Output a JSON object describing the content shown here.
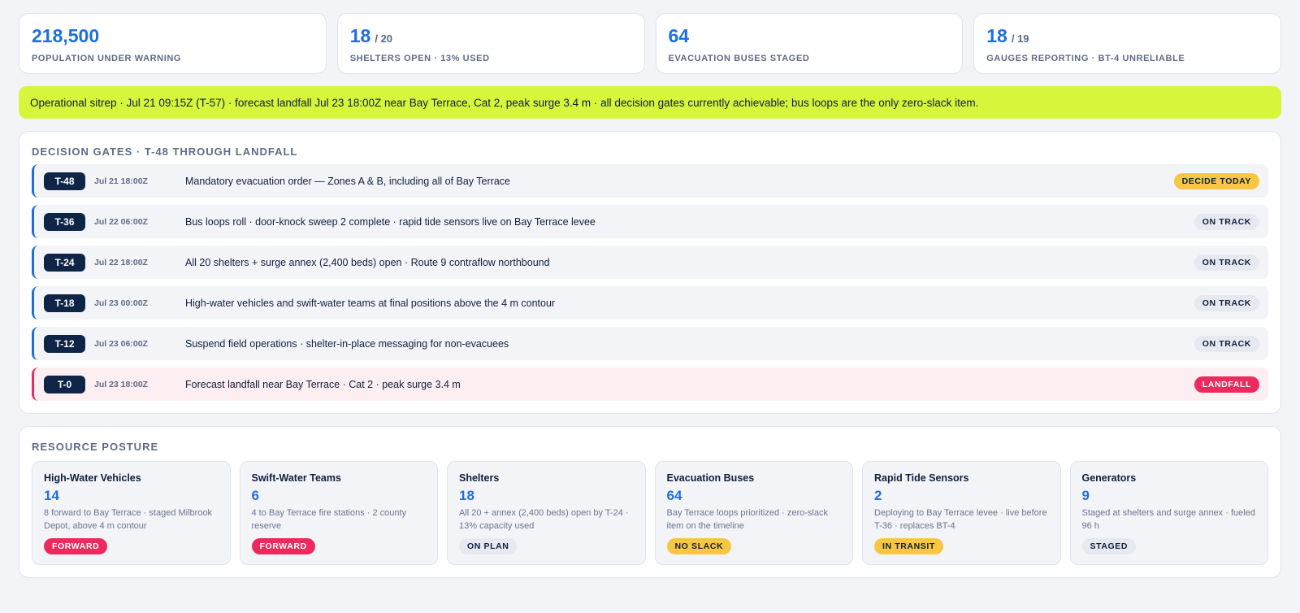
{
  "kpis": [
    {
      "value": "218,500",
      "denominator": "",
      "label": "POPULATION UNDER WARNING"
    },
    {
      "value": "18",
      "denominator": "/ 20",
      "label": "SHELTERS OPEN · 13% USED"
    },
    {
      "value": "64",
      "denominator": "",
      "label": "EVACUATION BUSES STAGED"
    },
    {
      "value": "18",
      "denominator": "/ 19",
      "label": "GAUGES REPORTING · BT-4 UNRELIABLE"
    }
  ],
  "banner": "Operational sitrep · Jul 21 09:15Z (T-57) · forecast landfall Jul 23 18:00Z near Bay Terrace, Cat 2, peak surge 3.4 m · all decision gates currently achievable; bus loops are the only zero-slack item.",
  "gates_section": {
    "title": "DECISION GATES · T-48 THROUGH LANDFALL",
    "gates": [
      {
        "tag": "T-48",
        "time": "Jul 21 18:00Z",
        "desc": "Mandatory evacuation order — Zones A & B, including all of Bay Terrace",
        "status": "DECIDE TODAY",
        "tone": "yellow"
      },
      {
        "tag": "T-36",
        "time": "Jul 22 06:00Z",
        "desc": "Bus loops roll · door-knock sweep 2 complete · rapid tide sensors live on Bay Terrace levee",
        "status": "ON TRACK",
        "tone": "grey"
      },
      {
        "tag": "T-24",
        "time": "Jul 22 18:00Z",
        "desc": "All 20 shelters + surge annex (2,400 beds) open · Route 9 contraflow northbound",
        "status": "ON TRACK",
        "tone": "grey"
      },
      {
        "tag": "T-18",
        "time": "Jul 23 00:00Z",
        "desc": "High-water vehicles and swift-water teams at final positions above the 4 m contour",
        "status": "ON TRACK",
        "tone": "grey"
      },
      {
        "tag": "T-12",
        "time": "Jul 23 06:00Z",
        "desc": "Suspend field operations · shelter-in-place messaging for non-evacuees",
        "status": "ON TRACK",
        "tone": "grey"
      },
      {
        "tag": "T-0",
        "time": "Jul 23 18:00Z",
        "desc": "Forecast landfall near Bay Terrace · Cat 2 · peak surge 3.4 m",
        "status": "LANDFALL",
        "tone": "red"
      }
    ]
  },
  "resources_section": {
    "title": "RESOURCE POSTURE",
    "items": [
      {
        "title": "High-Water Vehicles",
        "value": "14",
        "note": "8 forward to Bay Terrace · staged Milbrook Depot, above 4 m contour",
        "status": "FORWARD",
        "tone": "red"
      },
      {
        "title": "Swift-Water Teams",
        "value": "6",
        "note": "4 to Bay Terrace fire stations · 2 county reserve",
        "status": "FORWARD",
        "tone": "red"
      },
      {
        "title": "Shelters",
        "value": "18",
        "note": "All 20 + annex (2,400 beds) open by T-24 · 13% capacity used",
        "status": "ON PLAN",
        "tone": "grey"
      },
      {
        "title": "Evacuation Buses",
        "value": "64",
        "note": "Bay Terrace loops prioritized · zero-slack item on the timeline",
        "status": "NO SLACK",
        "tone": "yellow"
      },
      {
        "title": "Rapid Tide Sensors",
        "value": "2",
        "note": "Deploying to Bay Terrace levee · live before T-36 · replaces BT-4",
        "status": "IN TRANSIT",
        "tone": "yellow"
      },
      {
        "title": "Generators",
        "value": "9",
        "note": "Staged at shelters and surge annex · fueled 96 h",
        "status": "STAGED",
        "tone": "grey"
      }
    ]
  }
}
